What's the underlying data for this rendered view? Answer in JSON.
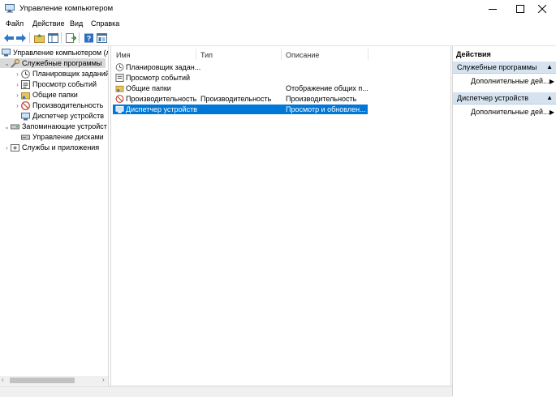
{
  "window": {
    "title": "Управление компьютером",
    "controls": [
      "minimize-icon",
      "maximize-icon",
      "close-icon"
    ]
  },
  "menu": {
    "items": [
      {
        "label": "Файл"
      },
      {
        "label": "Действие"
      },
      {
        "label": "Вид"
      },
      {
        "label": "Справка"
      }
    ]
  },
  "toolbar": {
    "buttons": [
      "back-arrow-icon",
      "forward-arrow-icon",
      "up-folder-icon",
      "show-hide-tree-icon",
      "export-list-icon",
      "help-icon",
      "properties-icon"
    ]
  },
  "tree": {
    "root": "Управление компьютером (л",
    "items": [
      {
        "label": "Служебные программы",
        "level": 1,
        "expanded": true,
        "selected": true,
        "icon": "tools-icon"
      },
      {
        "label": "Планировщик заданий",
        "level": 2,
        "icon": "clock-icon"
      },
      {
        "label": "Просмотр событий",
        "level": 2,
        "icon": "event-viewer-icon"
      },
      {
        "label": "Общие папки",
        "level": 2,
        "icon": "shared-folder-icon"
      },
      {
        "label": "Производительность",
        "level": 2,
        "icon": "performance-icon"
      },
      {
        "label": "Диспетчер устройств",
        "level": 2,
        "icon": "device-manager-icon"
      },
      {
        "label": "Запоминающие устройст",
        "level": 1,
        "expanded": true,
        "icon": "storage-icon"
      },
      {
        "label": "Управление дисками",
        "level": 2,
        "icon": "disk-icon"
      },
      {
        "label": "Службы и приложения",
        "level": 1,
        "icon": "services-icon"
      }
    ]
  },
  "list": {
    "columns": [
      "Имя",
      "Тип",
      "Описание"
    ],
    "rows": [
      {
        "name": "Планировщик задан...",
        "type": "",
        "desc": "",
        "icon": "clock-icon"
      },
      {
        "name": "Просмотр событий",
        "type": "",
        "desc": "",
        "icon": "event-viewer-icon"
      },
      {
        "name": "Общие папки",
        "type": "",
        "desc": "Отображение общих п...",
        "icon": "shared-folder-icon"
      },
      {
        "name": "Производительность",
        "type": "Производительность",
        "desc": "Производительность",
        "icon": "performance-icon"
      },
      {
        "name": "Диспетчер устройств",
        "type": "",
        "desc": "Просмотр и обновлен...",
        "icon": "device-manager-icon",
        "selected": true
      }
    ]
  },
  "actions": {
    "title": "Действия",
    "sections": [
      {
        "header": "Служебные программы",
        "item": "Дополнительные дей..."
      },
      {
        "header": "Диспетчер устройств",
        "item": "Дополнительные дей..."
      }
    ]
  }
}
